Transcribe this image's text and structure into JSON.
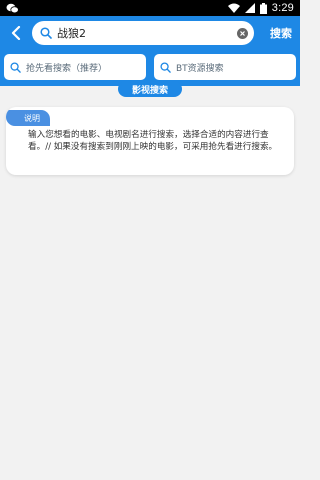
{
  "statusbar": {
    "time": "3:29"
  },
  "header": {
    "search_value": "战狼2",
    "search_button": "搜索"
  },
  "sources": [
    {
      "label": "抢先看搜索（推荐）"
    },
    {
      "label": "BT资源搜索"
    }
  ],
  "section_tab": "影视搜索",
  "info_card": {
    "badge": "说明",
    "text": "输入您想看的电影、电视剧名进行搜索，选择合适的内容进行查看。// 如果没有搜索到刚刚上映的电影，可采用抢先看进行搜索。"
  },
  "colors": {
    "primary": "#1e88e5",
    "badge": "#4a90e2"
  }
}
